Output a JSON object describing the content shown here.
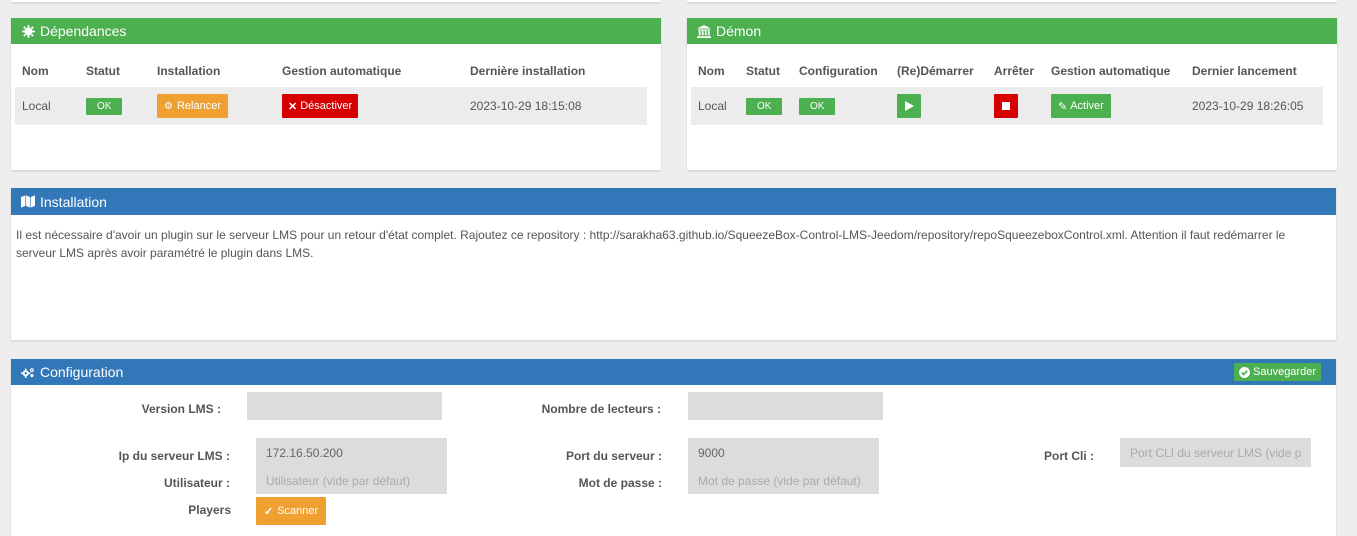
{
  "dependencies": {
    "title": "Dépendances",
    "headers": [
      "Nom",
      "Statut",
      "Installation",
      "Gestion automatique",
      "Dernière installation"
    ],
    "row": {
      "name": "Local",
      "status": "OK",
      "install_button": "Relancer",
      "auto_button": "Désactiver",
      "last_install": "2023-10-29 18:15:08"
    }
  },
  "daemon": {
    "title": "Démon",
    "headers": [
      "Nom",
      "Statut",
      "Configuration",
      "(Re)Démarrer",
      "Arrêter",
      "Gestion automatique",
      "Dernier lancement"
    ],
    "row": {
      "name": "Local",
      "status": "OK",
      "configuration": "OK",
      "auto_button": "Activer",
      "last_launch": "2023-10-29 18:26:05"
    }
  },
  "installation": {
    "title": "Installation",
    "text": "Il est nécessaire d'avoir un plugin sur le serveur LMS pour un retour d'état complet. Rajoutez ce repository : http://sarakha63.github.io/SqueezeBox-Control-LMS-Jeedom/repository/repoSqueezeboxControl.xml. Attention il faut redémarrer le serveur LMS après avoir paramétré le plugin dans LMS."
  },
  "configuration": {
    "title": "Configuration",
    "save_button": "Sauvegarder",
    "fields": {
      "version_lms": {
        "label": "Version LMS :",
        "value": ""
      },
      "nb_players": {
        "label": "Nombre de lecteurs :",
        "value": ""
      },
      "server_ip": {
        "label": "Ip du serveur LMS :",
        "value": "172.16.50.200"
      },
      "server_port": {
        "label": "Port du serveur :",
        "value": "9000"
      },
      "cli_port": {
        "label": "Port Cli :",
        "value": "",
        "placeholder": "Port CLI du serveur LMS (vide par défaut)"
      },
      "user": {
        "label": "Utilisateur :",
        "value": "",
        "placeholder": "Utilisateur (vide par défaut)"
      },
      "password": {
        "label": "Mot de passe :",
        "value": "",
        "placeholder": "Mot de passe (vide par défaut)"
      },
      "players": {
        "label": "Players"
      }
    },
    "scan_button": "Scanner"
  },
  "colors": {
    "green": "#4caf50",
    "blue": "#3277b8",
    "orange": "#f0a030",
    "red": "#d60000"
  }
}
